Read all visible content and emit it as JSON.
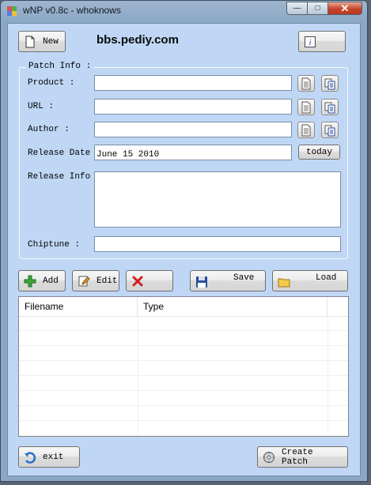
{
  "window": {
    "title": "wNP v0.8c - whoknows",
    "minimize_glyph": "—",
    "maximize_glyph": "□",
    "close_glyph": "✕"
  },
  "toolbar": {
    "new_label": "New",
    "site_text": "bbs.pediy.com",
    "info_glyph": "i"
  },
  "patch_info": {
    "legend": "Patch Info :",
    "product_label": "Product :",
    "product_value": "",
    "url_label": "URL :",
    "url_value": "",
    "author_label": "Author :",
    "author_value": "",
    "release_date_label": "Release Date :",
    "release_date_value": "June 15 2010",
    "today_label": "today",
    "release_info_label": "Release Info :",
    "release_info_value": "",
    "chiptune_label": "Chiptune :",
    "chiptune_value": ""
  },
  "actions": {
    "add_label": "Add",
    "edit_label": "Edit",
    "delete_label": "",
    "save_label": "Save",
    "load_label": "Load"
  },
  "file_list": {
    "columns": [
      "Filename",
      "Type"
    ],
    "rows": []
  },
  "footer": {
    "exit_label": "exit",
    "create_patch_label": "Create Patch"
  },
  "colors": {
    "client_bg": "#bfd7f5",
    "frame": "#8aa7c5",
    "close_button": "#c7432a"
  },
  "icons": {
    "new": "blank-document-icon",
    "info": "info-icon",
    "doc": "document-icon",
    "paste": "clipboard-icon",
    "add": "green-plus-icon",
    "edit": "pencil-icon",
    "delete": "red-x-icon",
    "save": "floppy-disk-icon",
    "load": "folder-icon",
    "exit": "undo-arrow-icon",
    "create": "gear-cd-icon"
  }
}
